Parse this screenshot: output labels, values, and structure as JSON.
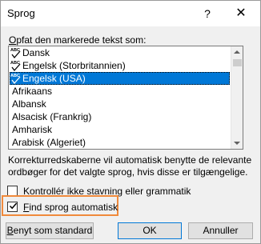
{
  "dialog": {
    "title": "Sprog",
    "help_label": "?",
    "close_label": "✕"
  },
  "section_label_first": "O",
  "section_label_rest": "pfat den markerede tekst som:",
  "languages": [
    {
      "label": "Dansk",
      "spellcheck": true,
      "selected": false
    },
    {
      "label": "Engelsk (Storbritannien)",
      "spellcheck": true,
      "selected": false
    },
    {
      "label": "Engelsk (USA)",
      "spellcheck": true,
      "selected": true
    },
    {
      "label": "Afrikaans",
      "spellcheck": false,
      "selected": false
    },
    {
      "label": "Albansk",
      "spellcheck": false,
      "selected": false
    },
    {
      "label": "Alsacisk (Frankrig)",
      "spellcheck": false,
      "selected": false
    },
    {
      "label": "Amharisk",
      "spellcheck": false,
      "selected": false
    },
    {
      "label": "Arabisk (Algeriet)",
      "spellcheck": false,
      "selected": false
    }
  ],
  "info_text": "Korrekturredskaberne vil automatisk benytte de relevante ordbøger for det valgte sprog, hvis disse er tilgængelige.",
  "checkboxes": {
    "no_spellcheck": {
      "first": "K",
      "rest": "ontrollér ikke stavning eller grammatik",
      "checked": false
    },
    "detect_language": {
      "first": "F",
      "rest": "ind sprog automatisk",
      "checked": true
    }
  },
  "buttons": {
    "default_first": "B",
    "default_rest": "enyt som standard",
    "ok": "OK",
    "cancel": "Annuller"
  },
  "colors": {
    "selection": "#0078d7",
    "highlight_border": "#f08a3c"
  }
}
